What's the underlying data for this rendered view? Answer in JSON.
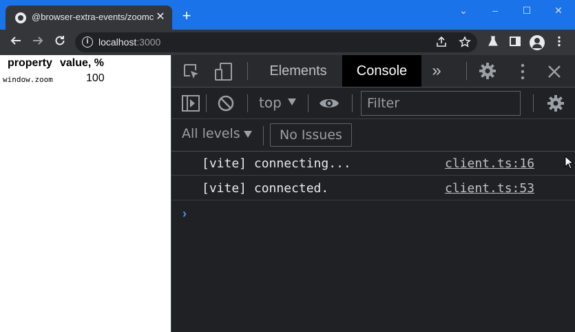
{
  "browser": {
    "tab_title": "@browser-extra-events/zoomcha",
    "tab_close": "✕",
    "new_tab": "+",
    "window_controls": {
      "minimize": "‒",
      "maximize": "☐",
      "close": "✕",
      "collapse": "⌄"
    }
  },
  "toolbar": {
    "url_host": "localhost",
    "url_port": ":3000",
    "icons": [
      "back-arrow-icon",
      "forward-arrow-icon",
      "reload-icon",
      "site-info-icon",
      "share-icon",
      "bookmark-star-icon",
      "labs-flask-icon",
      "side-panel-icon",
      "profile-avatar-icon",
      "menu-kebab-icon"
    ]
  },
  "page": {
    "headers": [
      "property",
      "value, %"
    ],
    "rows": [
      {
        "property": "window.zoom",
        "value": "100"
      }
    ]
  },
  "devtools": {
    "tabs": [
      "Elements",
      "Console"
    ],
    "active_tab": "Console",
    "more_tabs": "»",
    "context": "top",
    "filter_placeholder": "Filter",
    "levels": "All levels",
    "issues": "No Issues",
    "messages": [
      {
        "text": "[vite] connecting...",
        "source": "client.ts:16"
      },
      {
        "text": "[vite] connected.",
        "source": "client.ts:53"
      }
    ],
    "prompt": "›"
  },
  "colors": {
    "titlebar": "#1a73e8",
    "toolbar": "#35363a",
    "devtools_bg": "#202124",
    "console_active_tab": "#000000",
    "prompt": "#4d8ff0"
  }
}
